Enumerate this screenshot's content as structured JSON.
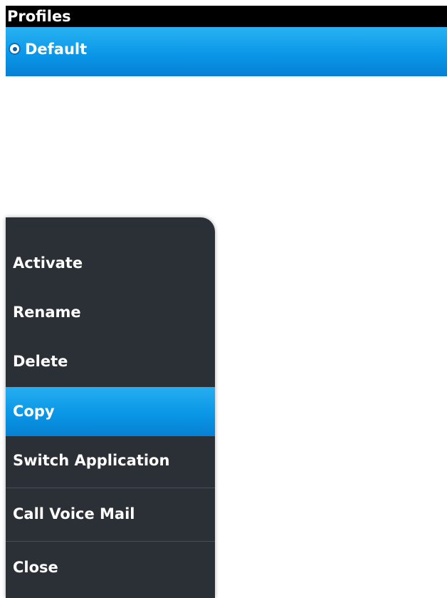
{
  "title": "Profiles",
  "profiles": [
    {
      "label": "Default",
      "selected": true
    }
  ],
  "menu": {
    "items": [
      {
        "label": "Activate"
      },
      {
        "label": "Rename"
      },
      {
        "label": "Delete"
      },
      {
        "label": "Copy",
        "selected": true
      },
      {
        "label": "Switch Application"
      },
      {
        "label": "Call Voice Mail"
      },
      {
        "label": "Close"
      }
    ]
  },
  "colors": {
    "titlebar_bg": "#000000",
    "highlight": "#0a96e6",
    "menu_bg": "#2b2f36",
    "text": "#ffffff"
  }
}
